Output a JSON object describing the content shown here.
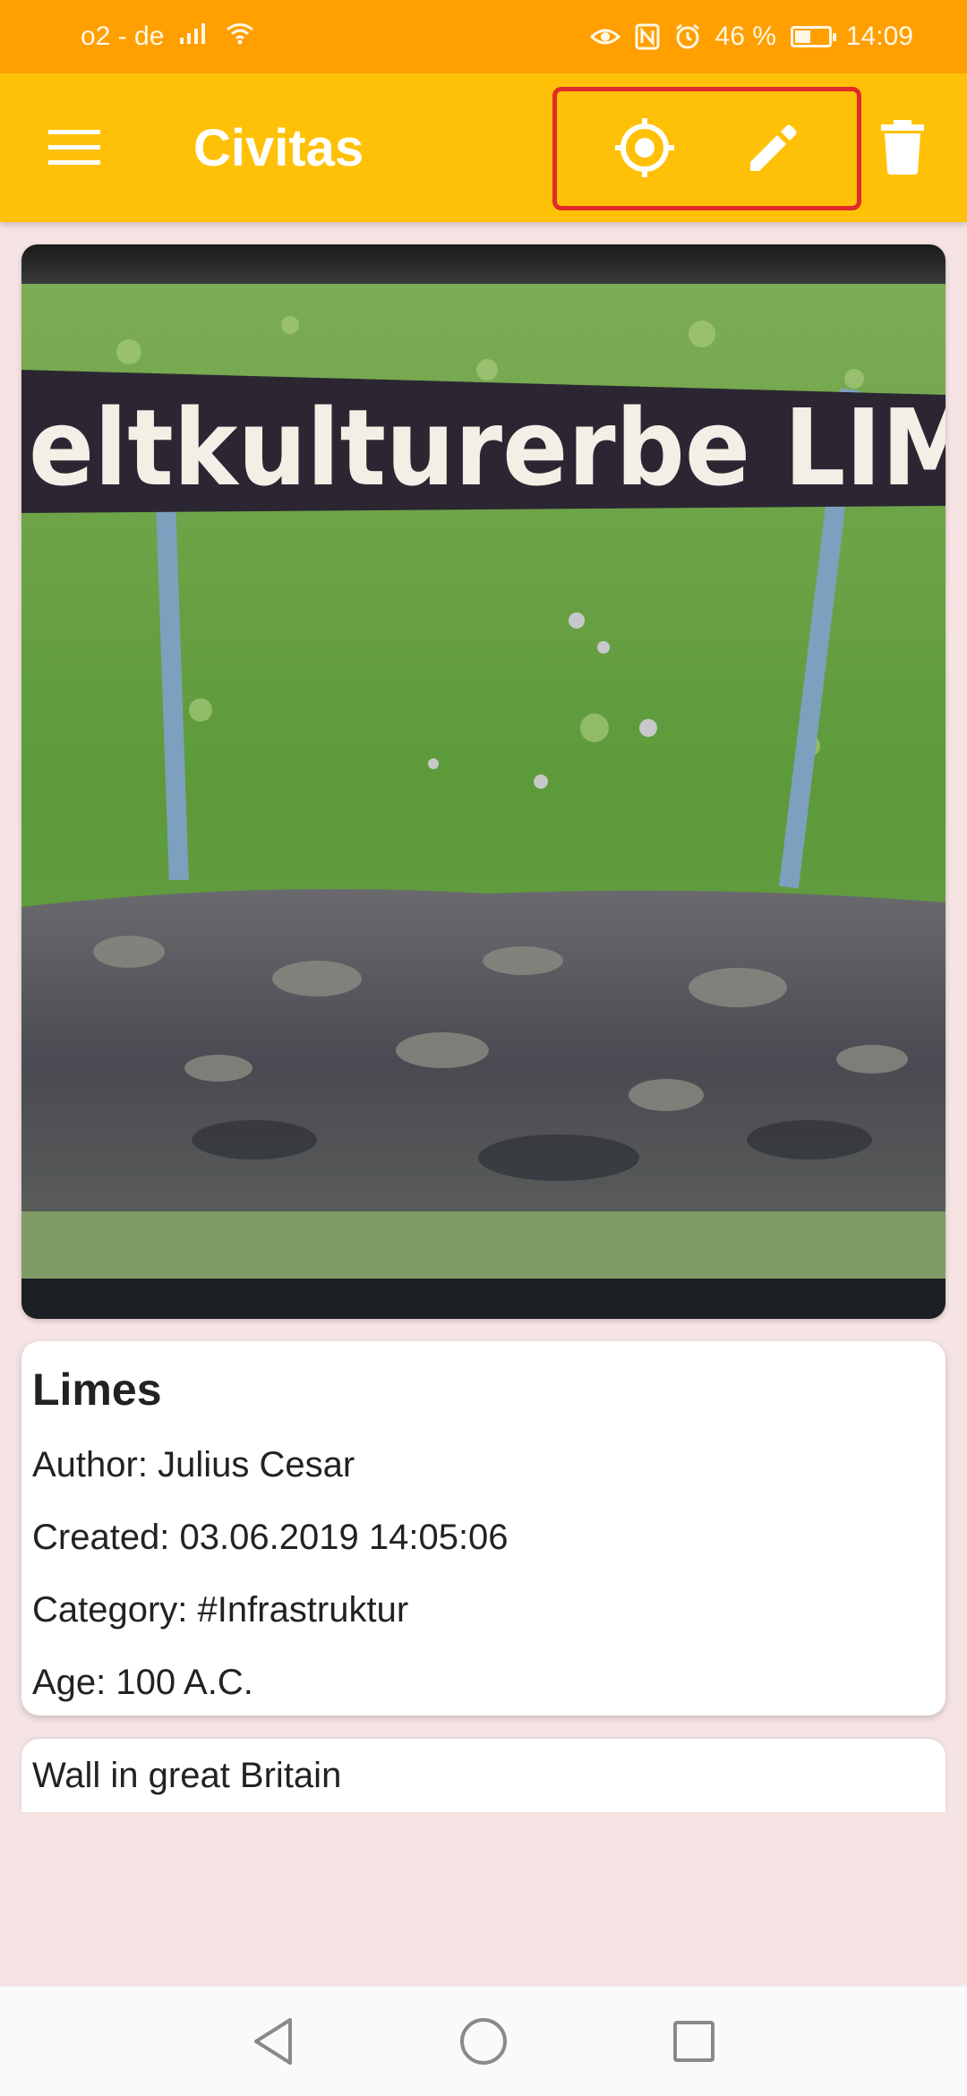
{
  "status_bar": {
    "carrier": "o2 - de",
    "battery": "46 %",
    "battery_level": 0.46,
    "time": "14:09",
    "icons": [
      "signal-icon",
      "wifi-icon",
      "eye-icon",
      "nfc-icon",
      "alarm-icon",
      "battery-icon"
    ]
  },
  "app_bar": {
    "title": "Civitas",
    "actions": [
      "locate-icon",
      "edit-icon",
      "delete-icon"
    ]
  },
  "photo": {
    "sign_text": "eltkulturerbe LIM"
  },
  "info": {
    "title": "Limes",
    "author": "Author: Julius Cesar",
    "created": "Created: 03.06.2019 14:05:06",
    "category": "Category: #Infrastruktur",
    "age": "Age: 100 A.C."
  },
  "description": "Wall in great Britain",
  "nav": {
    "icons": [
      "back-icon",
      "home-icon",
      "recents-icon"
    ]
  },
  "colors": {
    "status_bar": "#ff9f00",
    "app_bar": "#ffc107",
    "background": "#f6e3e3",
    "highlight": "#e02b2b"
  }
}
